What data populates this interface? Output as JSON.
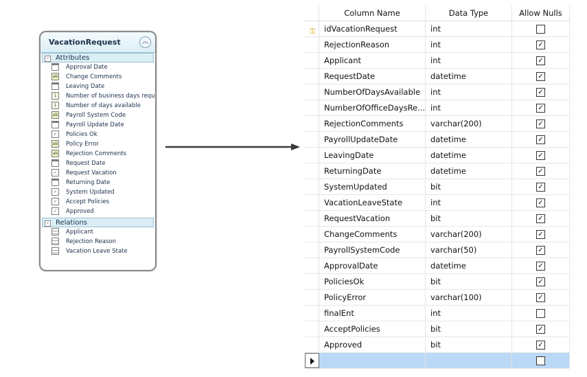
{
  "entity": {
    "title": "VacationRequest",
    "attributes_label": "Attributes",
    "relations_label": "Relations",
    "attributes": [
      {
        "label": "Approval Date",
        "icon": "date"
      },
      {
        "label": "Change Comments",
        "icon": "text"
      },
      {
        "label": "Leaving Date",
        "icon": "date"
      },
      {
        "label": "Number of business days requ",
        "icon": "number"
      },
      {
        "label": "Number of days available",
        "icon": "number"
      },
      {
        "label": "Payroll System Code",
        "icon": "text"
      },
      {
        "label": "Payroll Update Date",
        "icon": "date"
      },
      {
        "label": "Policies Ok",
        "icon": "check"
      },
      {
        "label": "Policy Error",
        "icon": "text"
      },
      {
        "label": "Rejection Comments",
        "icon": "text"
      },
      {
        "label": "Request Date",
        "icon": "date"
      },
      {
        "label": "Request Vacation",
        "icon": "check"
      },
      {
        "label": "Returning Date",
        "icon": "date"
      },
      {
        "label": "System Updated",
        "icon": "check"
      },
      {
        "label": "Accept Policies",
        "icon": "check"
      },
      {
        "label": "Approved",
        "icon": "check"
      }
    ],
    "relations": [
      {
        "label": "Applicant",
        "icon": "relation"
      },
      {
        "label": "Rejection Reason",
        "icon": "relation"
      },
      {
        "label": "Vacation Leave State",
        "icon": "relation"
      }
    ]
  },
  "grid": {
    "headers": {
      "column_name": "Column Name",
      "data_type": "Data Type",
      "allow_nulls": "Allow Nulls"
    },
    "rows": [
      {
        "name": "idVacationRequest",
        "type": "int",
        "nullable": false,
        "primary_key": true
      },
      {
        "name": "RejectionReason",
        "type": "int",
        "nullable": true
      },
      {
        "name": "Applicant",
        "type": "int",
        "nullable": true
      },
      {
        "name": "RequestDate",
        "type": "datetime",
        "nullable": true
      },
      {
        "name": "NumberOfDaysAvailable",
        "type": "int",
        "nullable": true
      },
      {
        "name": "NumberOfOfficeDaysRe...",
        "type": "int",
        "nullable": true
      },
      {
        "name": "RejectionComments",
        "type": "varchar(200)",
        "nullable": true
      },
      {
        "name": "PayrollUpdateDate",
        "type": "datetime",
        "nullable": true
      },
      {
        "name": "LeavingDate",
        "type": "datetime",
        "nullable": true
      },
      {
        "name": "ReturningDate",
        "type": "datetime",
        "nullable": true
      },
      {
        "name": "SystemUpdated",
        "type": "bit",
        "nullable": true
      },
      {
        "name": "VacationLeaveState",
        "type": "int",
        "nullable": true
      },
      {
        "name": "RequestVacation",
        "type": "bit",
        "nullable": true
      },
      {
        "name": "ChangeComments",
        "type": "varchar(200)",
        "nullable": true
      },
      {
        "name": "PayrollSystemCode",
        "type": "varchar(50)",
        "nullable": true
      },
      {
        "name": "ApprovalDate",
        "type": "datetime",
        "nullable": true
      },
      {
        "name": "PoliciesOk",
        "type": "bit",
        "nullable": true
      },
      {
        "name": "PolicyError",
        "type": "varchar(100)",
        "nullable": true
      },
      {
        "name": "finalEnt",
        "type": "int",
        "nullable": false
      },
      {
        "name": "AcceptPolicies",
        "type": "bit",
        "nullable": true
      },
      {
        "name": "Approved",
        "type": "bit",
        "nullable": true
      }
    ],
    "new_row": {
      "name": "",
      "type": "",
      "nullable": false
    }
  },
  "colors": {
    "selection": "#b9d9f6",
    "header_accent": "#dbeef6"
  }
}
